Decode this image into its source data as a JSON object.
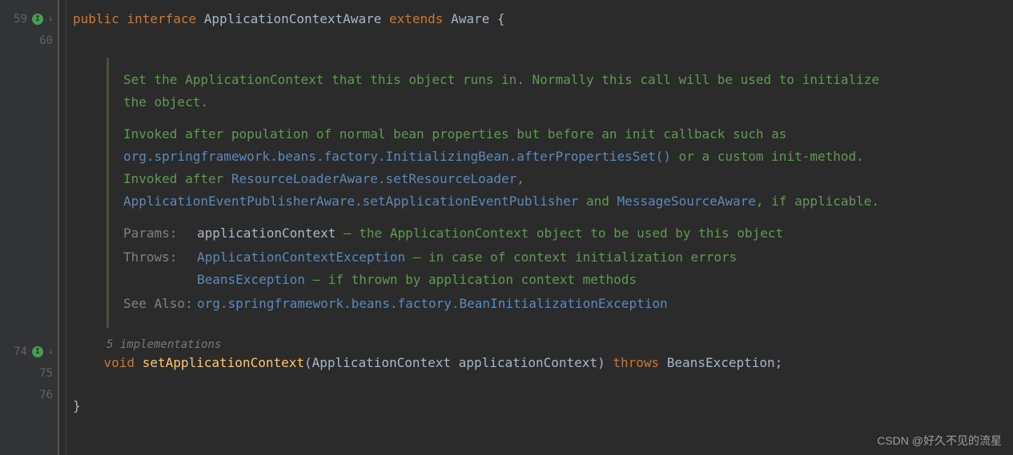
{
  "gutter": {
    "line59": "59",
    "line60": "60",
    "line74": "74",
    "line75": "75",
    "line76": "76"
  },
  "code": {
    "kw_public": "public",
    "kw_interface": "interface",
    "type_main": "ApplicationContextAware",
    "kw_extends": "extends",
    "type_parent": "Aware",
    "brace_open": "{",
    "kw_void": "void",
    "method": "setApplicationContext",
    "paren_open": "(",
    "param_type": "ApplicationContext",
    "param_name": "applicationContext",
    "paren_close": ")",
    "kw_throws": "throws",
    "throws_type": "BeansException",
    "semi": ";",
    "brace_close": "}"
  },
  "javadoc": {
    "p1": "Set the ApplicationContext that this object runs in. Normally this call will be used to initialize the object.",
    "p2a": "Invoked after population of normal bean properties but before an init callback such as ",
    "p2_link1": "org.springframework.beans.factory.InitializingBean.afterPropertiesSet()",
    "p2b": " or a custom init-method. Invoked after ",
    "p2_link2": "ResourceLoaderAware.setResourceLoader",
    "p2c": ", ",
    "p2_link3": "ApplicationEventPublisherAware.setApplicationEventPublisher",
    "p2d": " and ",
    "p2_link4": "MessageSourceAware",
    "p2e": ", if applicable.",
    "params_label": "Params:",
    "params_name": "applicationContext",
    "params_desc": " – the ApplicationContext object to be used by this object",
    "throws_label": "Throws:",
    "throws1_link": "ApplicationContextException",
    "throws1_desc": " – in case of context initialization errors",
    "throws2_link": "BeansException",
    "throws2_desc": " – if thrown by application context methods",
    "seealso_label": "See Also:",
    "seealso_link": "org.springframework.beans.factory.BeanInitializationException"
  },
  "hint": "5 implementations",
  "watermark": "CSDN @好久不见的流星"
}
